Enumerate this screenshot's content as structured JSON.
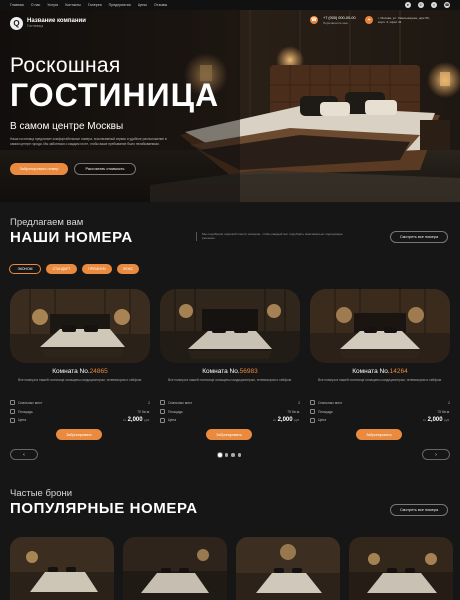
{
  "topnav": {
    "items": [
      "Главная",
      "О нас",
      "Услуги",
      "Контакты",
      "Галерея",
      "Предприятия",
      "Цены",
      "Отзывы"
    ],
    "icons": [
      "telegram-icon",
      "whatsapp-icon",
      "vk-icon",
      "phone-icon"
    ]
  },
  "header": {
    "company_name": "Название компании",
    "company_sub": "Гостиница",
    "phone": "+7 (000) 000-00-00",
    "phone_note": "Перезвоните мне",
    "address": "г. Москва, ул. Хмельницкая, дом 50,",
    "address2": "корп. 3, офис 31"
  },
  "hero": {
    "title_line1": "Роскошная",
    "title_line2": "ГОСТИНИЦА",
    "subtitle": "В самом центре Москвы",
    "text": "Наша гостиница предлагает комфортабельные номера, эксклюзивный сервис и удобное расположение в самом центре города. Мы заботимся о каждом госте, чтобы ваше пребывание было незабываемым.",
    "book_button": "Забронировать номер",
    "calc_button": "Рассчитать стоимость"
  },
  "rooms_section": {
    "small_title": "Предлагаем вам",
    "big_title": "НАШИ НОМЕРА",
    "description": "Мы подобрали широкий спектр номеров, чтобы каждый мог подобрать максимально подходящее решение.",
    "all_button": "Смотреть все номера",
    "filters": [
      "ЭКОНОМ",
      "СТАНДАРТ",
      "ПРЕМИУМ",
      "ЛЮКС"
    ],
    "cards": [
      {
        "name": "Комната No.",
        "num": "24865",
        "desc": "Все номера в нашей гостинице оснащены кондиционером, телевизором и сейфом.",
        "beds_label": "Спальных мест",
        "beds": "2",
        "area_label": "Площадь",
        "area": "70 Кв.м.",
        "price_label": "Цена",
        "price_from": "от",
        "price": "2,000",
        "price_unit": "руб.",
        "book": "Забронировать"
      },
      {
        "name": "Комната No.",
        "num": "56983",
        "desc": "Все номера в нашей гостинице оснащены кондиционером, телевизором и сейфом.",
        "beds_label": "Спальных мест",
        "beds": "2",
        "area_label": "Площадь",
        "area": "75 Кв.м.",
        "price_label": "Цена",
        "price_from": "от",
        "price": "2,000",
        "price_unit": "руб.",
        "book": "Забронировать"
      },
      {
        "name": "Комната No.",
        "num": "14264",
        "desc": "Все номера в нашей гостинице оснащены кондиционером, телевизором и сейфом.",
        "beds_label": "Спальных мест",
        "beds": "2",
        "area_label": "Площадь",
        "area": "75 Кв.м.",
        "price_label": "Цена",
        "price_from": "от",
        "price": "2,000",
        "price_unit": "руб.",
        "book": "Забронировать"
      }
    ],
    "prev": "‹",
    "next": "›"
  },
  "popular_section": {
    "small_title": "Частые брони",
    "big_title": "ПОПУЛЯРНЫЕ НОМЕРА",
    "all_button": "Смотреть все номера"
  },
  "colors": {
    "accent": "#ea8a3f",
    "background": "#161616"
  }
}
